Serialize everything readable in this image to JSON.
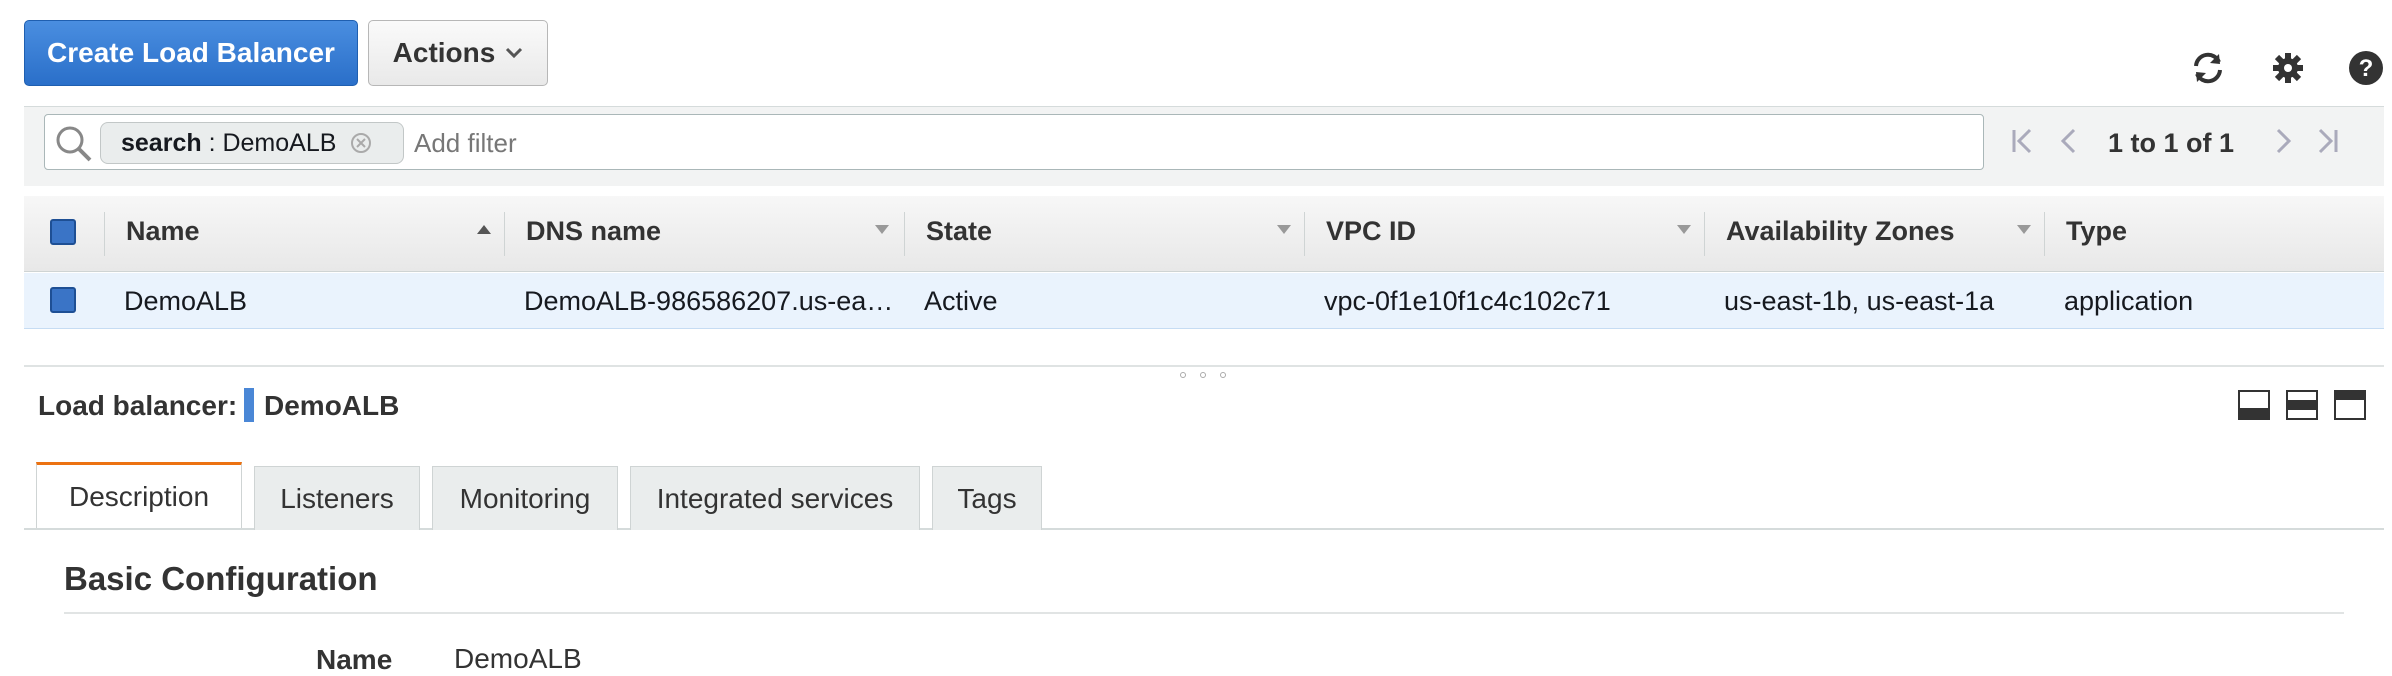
{
  "toolbar": {
    "create_label": "Create Load Balancer",
    "actions_label": "Actions",
    "icons": [
      "refresh-icon",
      "settings-icon",
      "help-icon"
    ]
  },
  "filter": {
    "token_key": "search",
    "token_sep": " : ",
    "token_value": "DemoALB",
    "placeholder": "Add filter",
    "pager_text": "1 to 1 of 1"
  },
  "table": {
    "columns": [
      "Name",
      "DNS name",
      "State",
      "VPC ID",
      "Availability Zones",
      "Type"
    ],
    "rows": [
      {
        "name": "DemoALB",
        "dns": "DemoALB-986586207.us-ea…",
        "state": "Active",
        "vpc": "vpc-0f1e10f1c4c102c71",
        "zones": "us-east-1b, us-east-1a",
        "type": "application"
      }
    ]
  },
  "detail": {
    "label": "Load balancer:",
    "name": "DemoALB",
    "tabs": [
      "Description",
      "Listeners",
      "Monitoring",
      "Integrated services",
      "Tags"
    ],
    "active_tab": "Description",
    "section_title": "Basic Configuration",
    "fields": [
      {
        "label": "Name",
        "value": "DemoALB"
      }
    ]
  },
  "colors": {
    "primary": "#2a6fc9",
    "row_selected": "#eaf3fd",
    "tab_accent": "#ec7211"
  }
}
